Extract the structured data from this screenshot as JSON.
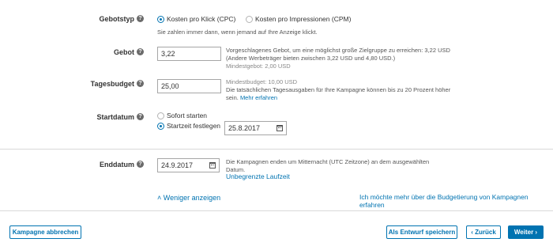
{
  "bid_type": {
    "label": "Gebotstyp",
    "option_cpc": "Kosten pro Klick (CPC)",
    "option_cpm": "Kosten pro Impressionen (CPM)",
    "hint": "Sie zahlen immer dann, wenn jemand auf Ihre Anzeige klickt."
  },
  "bid": {
    "label": "Gebot",
    "value": "3,22",
    "suggestion_line1": "Vorgeschlagenes Gebot, um eine möglichst große Zielgruppe zu erreichen: 3,22 USD",
    "suggestion_line2": "(Andere Werbeträger bieten zwischen 3,22 USD und 4,80 USD.)",
    "min": "Mindestgebot: 2,00 USD"
  },
  "daily_budget": {
    "label": "Tagesbudget",
    "value": "25,00",
    "min": "Mindestbudget: 10,00 USD",
    "info_line1": "Die tatsächlichen Tagesausgaben für Ihre Kampagne können bis zu 20 Prozent höher",
    "info_line2": "sein.",
    "learn_more": "Mehr erfahren"
  },
  "start_date": {
    "label": "Startdatum",
    "option_now": "Sofort starten",
    "option_set": "Startzeit festlegen",
    "value": "25.8.2017"
  },
  "end_date": {
    "label": "Enddatum",
    "value": "24.9.2017",
    "info_line1": "Die Kampagnen enden um Mitternacht (UTC Zeitzone) an dem ausgewählten",
    "info_line2": "Datum.",
    "unlimited_link": "Unbegrenzte Laufzeit"
  },
  "show_less": "Weniger anzeigen",
  "budget_info_link": "Ich möchte mehr über die Budgetierung von Kampagnen erfahren",
  "footer": {
    "cancel": "Kampagne abbrechen",
    "save_draft": "Als Entwurf speichern",
    "back": "‹ Zurück",
    "next": "Weiter ›"
  },
  "colors": {
    "accent": "#0073b1",
    "text": "#333333"
  }
}
